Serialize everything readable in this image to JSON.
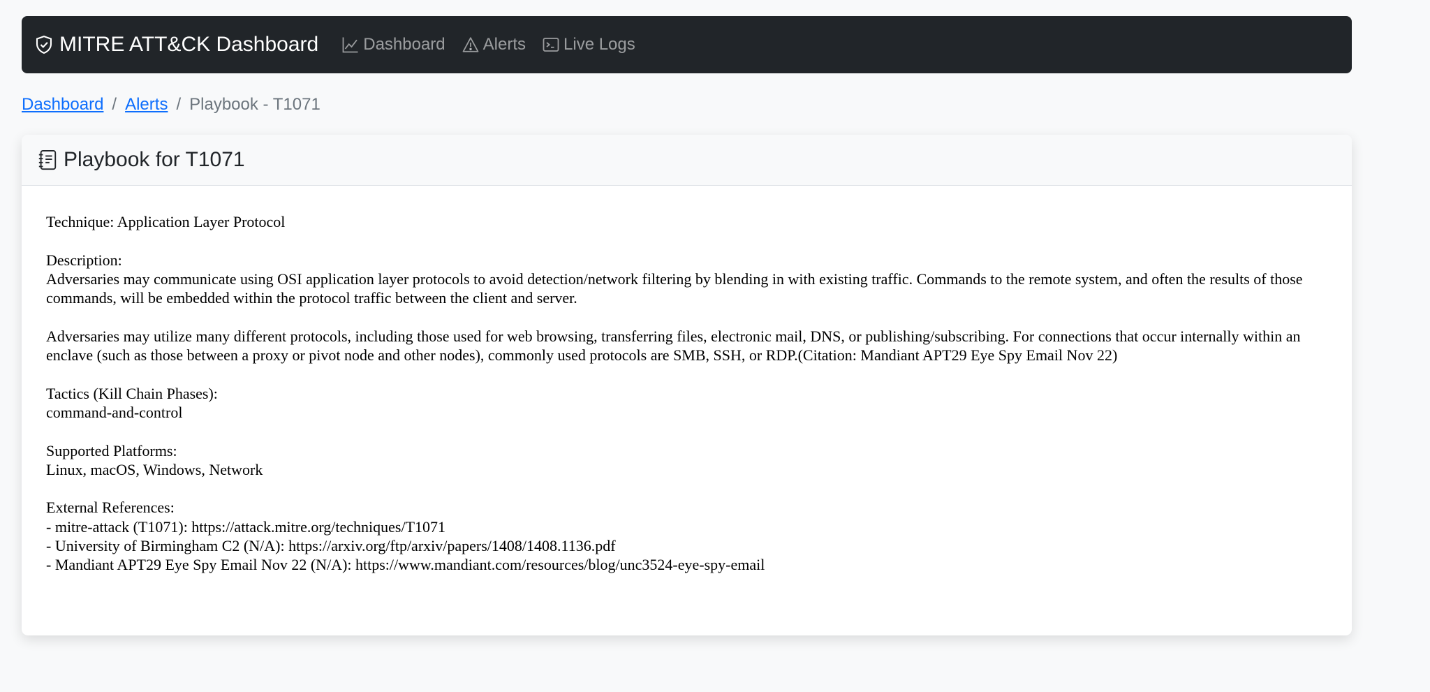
{
  "navbar": {
    "brand": "MITRE ATT&CK Dashboard",
    "brand_icon": "shield-check-icon",
    "links": [
      {
        "label": "Dashboard",
        "icon": "chart-line-icon"
      },
      {
        "label": "Alerts",
        "icon": "warning-triangle-icon"
      },
      {
        "label": "Live Logs",
        "icon": "terminal-icon"
      }
    ]
  },
  "breadcrumb": {
    "items": [
      "Dashboard",
      "Alerts"
    ],
    "current": "Playbook - T1071"
  },
  "card": {
    "title": "Playbook for T1071",
    "title_icon": "journal-text-icon",
    "technique": "Technique: Application Layer Protocol",
    "description_label": "Description:",
    "description_p1": "Adversaries may communicate using OSI application layer protocols to avoid detection/network filtering by blending in with existing traffic. Commands to the remote system, and often the results of those commands, will be embedded within the protocol traffic between the client and server.",
    "description_p2": "Adversaries may utilize many different protocols, including those used for web browsing, transferring files, electronic mail, DNS, or publishing/subscribing. For connections that occur internally within an enclave (such as those between a proxy or pivot node and other nodes), commonly used protocols are SMB, SSH, or RDP.(Citation: Mandiant APT29 Eye Spy Email Nov 22)",
    "tactics_label": "Tactics (Kill Chain Phases):",
    "tactics": "command-and-control",
    "platforms_label": "Supported Platforms:",
    "platforms": "Linux, macOS, Windows, Network",
    "references_label": "External References:",
    "references": [
      "- mitre-attack (T1071): https://attack.mitre.org/techniques/T1071",
      "- University of Birmingham C2 (N/A): https://arxiv.org/ftp/arxiv/papers/1408/1408.1136.pdf",
      "- Mandiant APT29 Eye Spy Email Nov 22 (N/A): https://www.mandiant.com/resources/blog/unc3524-eye-spy-email"
    ]
  },
  "colors": {
    "navbar_bg": "#212529",
    "page_bg": "#f8f9fa",
    "link": "#0d6efd",
    "muted": "#6c757d"
  }
}
